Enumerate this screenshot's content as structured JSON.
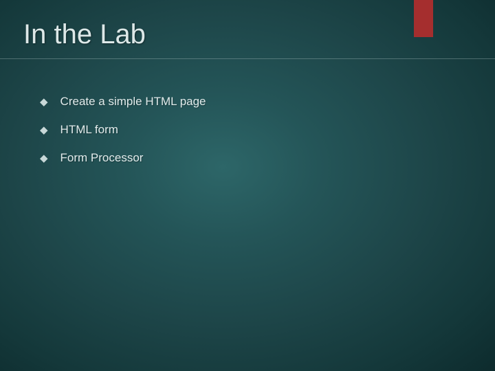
{
  "accent_color": "#a52e2e",
  "title": "In the Lab",
  "bullets": {
    "0": {
      "text": "Create a simple HTML page"
    },
    "1": {
      "text": "HTML form"
    },
    "2": {
      "text": "Form Processor"
    }
  }
}
